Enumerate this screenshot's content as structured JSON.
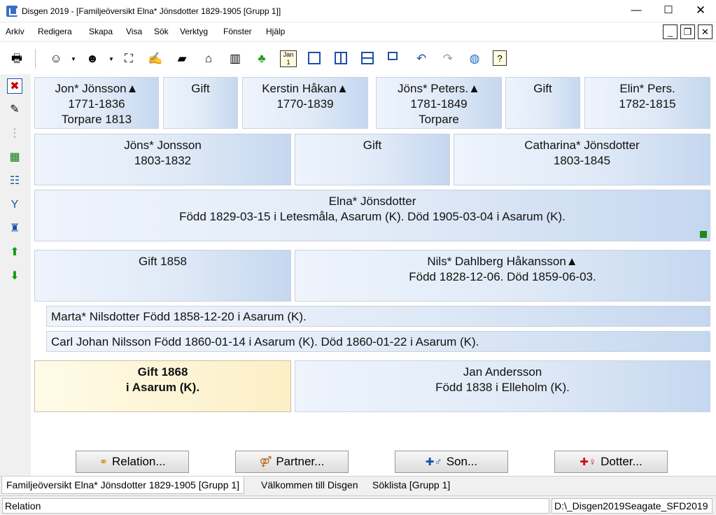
{
  "window": {
    "title": "Disgen 2019 - [Familjeöversikt Elna* Jönsdotter 1829-1905 [Grupp 1]]",
    "minimize": "—",
    "maximize": "☐",
    "close": "✕"
  },
  "menu": [
    "Arkiv",
    "Redigera",
    "Skapa",
    "Visa",
    "Sök",
    "Verktyg",
    "Fönster",
    "Hjälp"
  ],
  "mdi_controls": [
    "_",
    "❐",
    "✕"
  ],
  "toolbar_icons": [
    "print-icon",
    "person-icon",
    "person-search-icon",
    "binoculars-icon",
    "handshake-icon",
    "book-icon",
    "home-icon",
    "books-icon",
    "map-icon",
    "calendar-icon",
    "window-icon",
    "columns-icon",
    "rows-icon",
    "cascade-icon",
    "undo-icon",
    "redo-icon",
    "globe-icon",
    "help-icon"
  ],
  "calendar_label": "Jan 1",
  "help_label": "?",
  "sidebar_icons": [
    "delete-icon",
    "edit-icon",
    "tree-icon",
    "find-icon",
    "columns-icon",
    "ancestors-icon",
    "descendants-icon",
    "up-icon",
    "down-icon"
  ],
  "grandparents": [
    {
      "name": "Jon* Jönsson▲",
      "years": "1771-1836",
      "note": "Torpare  1813"
    },
    {
      "label": "Gift"
    },
    {
      "name": "Kerstin Håkan▲",
      "years": "1770-1839"
    },
    {
      "name": "Jöns* Peters.▲",
      "years": "1781-1849",
      "note": "Torpare"
    },
    {
      "label": "Gift"
    },
    {
      "name": "Elin* Pers.",
      "years": "1782-1815"
    }
  ],
  "parents": [
    {
      "name": "Jöns* Jonsson",
      "years": "1803-1832"
    },
    {
      "label": "Gift"
    },
    {
      "name": "Catharina* Jönsdotter",
      "years": "1803-1845"
    }
  ],
  "person": {
    "name": "Elna* Jönsdotter",
    "details": "Född 1829-03-15 i Letesmåla, Asarum (K). Död 1905-03-04 i Asarum (K)."
  },
  "marriage1": {
    "label": "Gift 1858",
    "spouse": "Nils* Dahlberg Håkansson▲",
    "spouse_details": "Född 1828-12-06. Död 1859-06-03."
  },
  "children": [
    "Marta* Nilsdotter Född 1858-12-20 i Asarum (K).",
    "Carl Johan Nilsson Född 1860-01-14 i Asarum (K). Död 1860-01-22 i Asarum (K)."
  ],
  "marriage2": {
    "label": "Gift 1868",
    "place": "i Asarum (K).",
    "spouse": "Jan Andersson",
    "spouse_details": "Född 1838 i Elleholm (K)."
  },
  "buttons": {
    "relation": "Relation...",
    "partner": "Partner...",
    "son": "Son...",
    "dotter": "Dotter..."
  },
  "tabs": [
    "Familjeöversikt Elna* Jönsdotter 1829-1905 [Grupp 1]",
    "Välkommen till Disgen",
    "Söklista [Grupp 1]"
  ],
  "status": {
    "left": "Relation",
    "right": "D:\\_Disgen2019Seagate_SFD2019"
  },
  "colors": {
    "marker": "#1b8a1b",
    "selected_card": "#fcefc6",
    "card": "#dde8f6"
  }
}
